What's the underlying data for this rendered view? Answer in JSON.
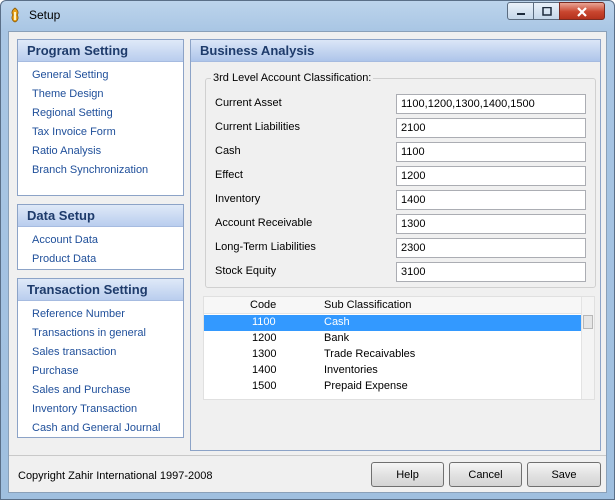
{
  "window": {
    "title": "Setup"
  },
  "sidebar": {
    "program_setting": {
      "title": "Program Setting",
      "items": [
        "General Setting",
        "Theme Design",
        "Regional Setting",
        "Tax Invoice Form",
        "Ratio Analysis",
        "Branch Synchronization"
      ]
    },
    "data_setup": {
      "title": "Data Setup",
      "items": [
        "Account Data",
        "Product Data"
      ]
    },
    "transaction_setting": {
      "title": "Transaction Setting",
      "items": [
        "Reference Number",
        "Transactions in general",
        "Sales transaction",
        "Purchase",
        "Sales and Purchase",
        "Inventory Transaction",
        "Cash and General Journal"
      ]
    }
  },
  "main": {
    "title": "Business Analysis",
    "group_label": "3rd Level Account Classification:",
    "fields": [
      {
        "label": "Current Asset",
        "value": "1100,1200,1300,1400,1500"
      },
      {
        "label": "Current Liabilities",
        "value": "2100"
      },
      {
        "label": "Cash",
        "value": "1100"
      },
      {
        "label": "Effect",
        "value": "1200"
      },
      {
        "label": "Inventory",
        "value": "1400"
      },
      {
        "label": "Account Receivable",
        "value": "1300"
      },
      {
        "label": "Long-Term Liabilities",
        "value": "2300"
      },
      {
        "label": "Stock Equity",
        "value": "3100"
      }
    ],
    "list": {
      "headers": [
        "Code",
        "Sub Classification"
      ],
      "rows": [
        [
          "1100",
          "Cash"
        ],
        [
          "1200",
          "Bank"
        ],
        [
          "1300",
          "Trade Recaivables"
        ],
        [
          "1400",
          "Inventories"
        ],
        [
          "1500",
          "Prepaid Expense"
        ]
      ],
      "selected_index": 0
    }
  },
  "footer": {
    "copyright": "Copyright Zahir International 1997-2008",
    "help_label": "Help",
    "cancel_label": "Cancel",
    "save_label": "Save"
  },
  "icons": {
    "app": "app-icon",
    "minimize": "minimize-icon",
    "maximize": "maximize-icon",
    "close": "close-icon"
  },
  "colors": {
    "link": "#1f4f9a",
    "panel_title": "#1e3b6b",
    "selection": "#3399ff",
    "close_button": "#c9462f"
  }
}
